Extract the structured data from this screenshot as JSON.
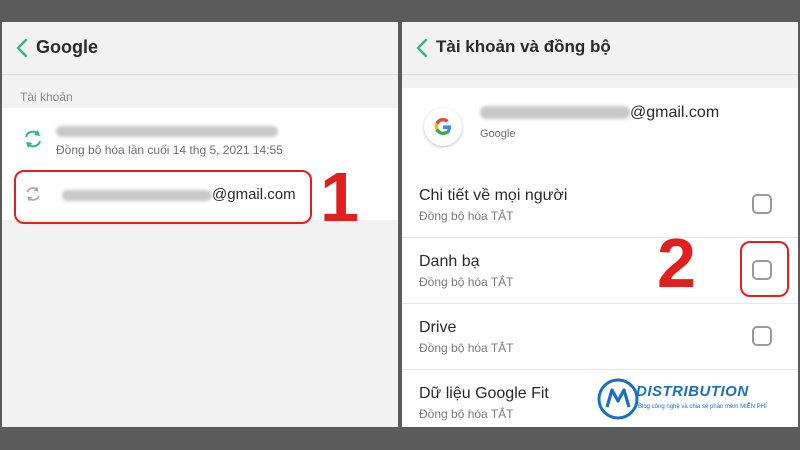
{
  "left_panel": {
    "title": "Google",
    "section_label": "Tài khoản",
    "accounts": [
      {
        "email_suffix": "",
        "status": "Đồng bộ hóa lần cuối 14 thg 5, 2021 14:55"
      },
      {
        "email_suffix": "@gmail.com"
      }
    ],
    "callout_number": "1"
  },
  "right_panel": {
    "title": "Tài khoản và đồng bộ",
    "account": {
      "email_suffix": "@gmail.com",
      "provider": "Google"
    },
    "sync_items": [
      {
        "title": "Chi tiết về mọi người",
        "status": "Đồng bộ hóa TẮT",
        "checked": false
      },
      {
        "title": "Danh bạ",
        "status": "Đồng bộ hóa TẮT",
        "checked": false
      },
      {
        "title": "Drive",
        "status": "Đồng bộ hóa TẮT",
        "checked": false
      },
      {
        "title": "Dữ liệu Google Fit",
        "status": "Đồng bộ hóa TẮT",
        "checked": false
      }
    ],
    "callout_number": "2"
  },
  "watermark": {
    "brand": "DISTRIBUTION",
    "tagline": "Blog công nghệ và chia sẻ phần mềm MIỄN PHÍ"
  },
  "icons": [
    "back-chevron-icon",
    "sync-icon",
    "google-logo-icon"
  ],
  "colors": {
    "accent_green": "#35b38a",
    "highlight_red": "#e01f1f",
    "brand_blue": "#1a6fc4"
  }
}
